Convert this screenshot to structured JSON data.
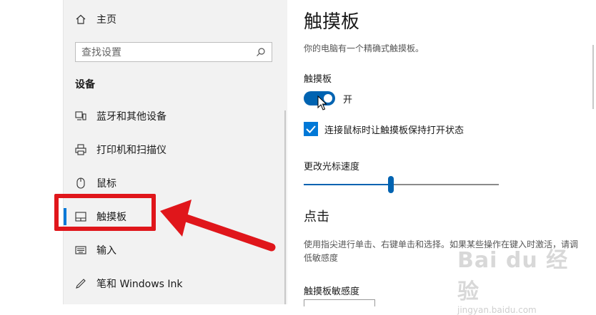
{
  "nav": {
    "home_label": "主页",
    "search_placeholder": "查找设置",
    "section_title": "设备",
    "items": [
      {
        "label": "蓝牙和其他设备",
        "icon": "bluetooth-devices-icon"
      },
      {
        "label": "打印机和扫描仪",
        "icon": "printer-icon"
      },
      {
        "label": "鼠标",
        "icon": "mouse-icon"
      },
      {
        "label": "触摸板",
        "icon": "touchpad-icon",
        "selected": true
      },
      {
        "label": "输入",
        "icon": "keyboard-icon"
      },
      {
        "label": "笔和 Windows Ink",
        "icon": "pen-icon"
      }
    ]
  },
  "main": {
    "title": "触摸板",
    "description": "你的电脑有一个精确式触摸板。",
    "toggle_label": "触摸板",
    "toggle_state": "开",
    "toggle_on": true,
    "checkbox_label": "连接鼠标时让触摸板保持打开状态",
    "checkbox_checked": true,
    "cursor_speed_label": "更改光标速度",
    "cursor_speed_value": 0.45,
    "tap_heading": "点击",
    "tap_description": "使用指尖进行单击、右键单击和选择。如果某些操作在键入时激活，请调低敏感度",
    "sensitivity_label": "触摸板敏感度"
  },
  "watermark": {
    "brand": "Bai du 经验",
    "url": "jingyan.baidu.com"
  },
  "colors": {
    "accent": "#0078d7",
    "highlight": "#e0161b",
    "nav_background": "#f2f2f2"
  }
}
